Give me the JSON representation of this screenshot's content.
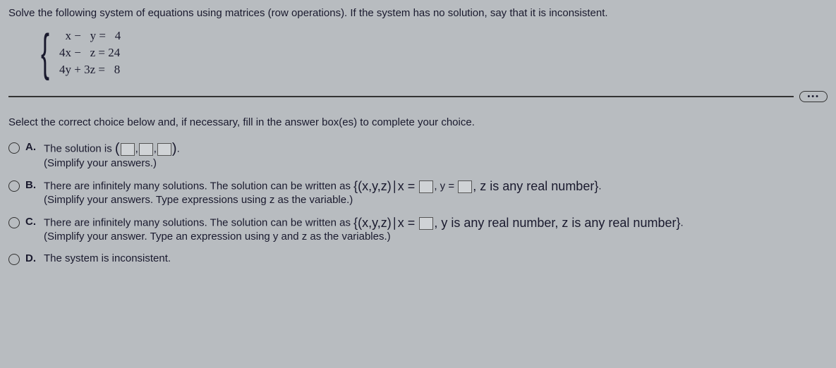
{
  "question": "Solve the following system of equations using matrices (row operations). If the system has no solution, say that it is inconsistent.",
  "equations": {
    "eq1": "  x −   y =   4",
    "eq2": "4x −   z = 24",
    "eq3": "4y + 3z =   8"
  },
  "instruction": "Select the correct choice below and, if necessary, fill in the answer box(es) to complete your choice.",
  "choices": {
    "A": {
      "letter": "A.",
      "prefix": "The solution is ",
      "suffix": ".",
      "note": "(Simplify your answers.)"
    },
    "B": {
      "letter": "B.",
      "prefix": "There are infinitely many solutions. The solution can be written as ",
      "set_open": "{(x,y,z)∣x = ",
      "mid1": ", y = ",
      "mid2": ", z is any real number}",
      "suffix": ".",
      "note": "(Simplify your answers. Type expressions using z as the variable.)"
    },
    "C": {
      "letter": "C.",
      "prefix": "There are infinitely many solutions. The solution can be written as ",
      "set_open": "{(x,y,z)∣x = ",
      "mid2": ", y is any real number, z is any real number}",
      "suffix": ".",
      "note": "(Simplify your answer. Type an expression using y and z as the variables.)"
    },
    "D": {
      "letter": "D.",
      "text": "The system is inconsistent."
    }
  },
  "dots": "•••"
}
